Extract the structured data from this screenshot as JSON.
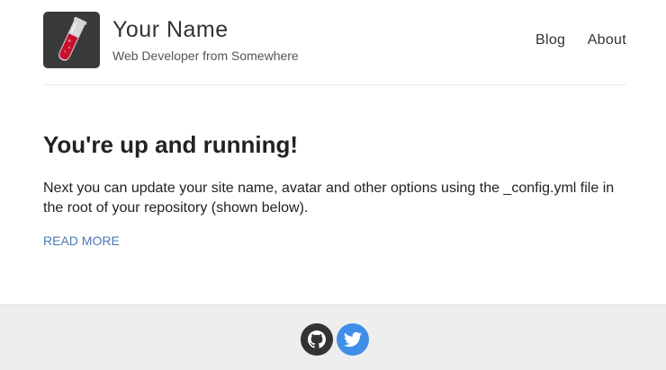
{
  "header": {
    "site_name": "Your Name",
    "site_description": "Web Developer from Somewhere",
    "avatar_icon": "test-tube-icon",
    "nav": [
      {
        "label": "Blog"
      },
      {
        "label": "About"
      }
    ]
  },
  "post": {
    "title": "You're up and running!",
    "excerpt": "Next you can update your site name, avatar and other options using the _config.yml file in the root of your repository (shown below).",
    "read_more": "READ MORE"
  },
  "footer": {
    "social": [
      {
        "icon": "github-icon",
        "color": "#333333"
      },
      {
        "icon": "twitter-icon",
        "color": "#3f8fe9"
      }
    ]
  },
  "colors": {
    "link": "#4a7ab8",
    "footer_bg": "#eeeeee"
  }
}
